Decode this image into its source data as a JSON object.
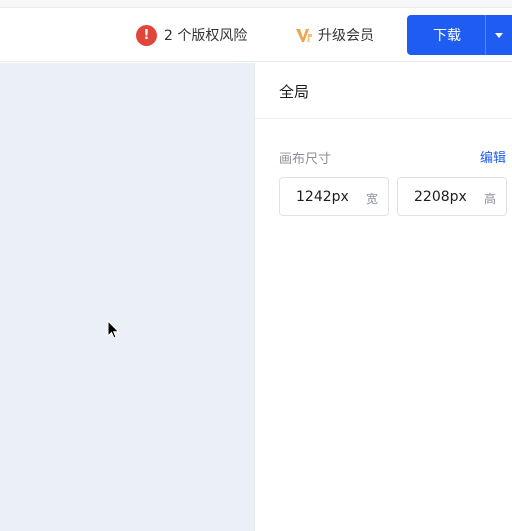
{
  "header": {
    "risk_count": "2",
    "risk_text": "2 个版权风险",
    "vip_text": "升级会员",
    "download_label": "下载"
  },
  "panel": {
    "title": "全局",
    "canvas_size_label": "画布尺寸",
    "edit_label": "编辑",
    "width_value": "1242px",
    "width_unit": "宽",
    "height_value": "2208px",
    "height_unit": "高"
  },
  "colors": {
    "accent": "#1f5df2",
    "risk": "#e1463a",
    "canvas_bg": "#ebeff7",
    "vip": "#f0a34a"
  },
  "icons": {
    "risk": "exclamation-icon",
    "vip": "vip-icon",
    "dropdown": "caret-down-icon",
    "cursor": "mouse-cursor-icon"
  }
}
